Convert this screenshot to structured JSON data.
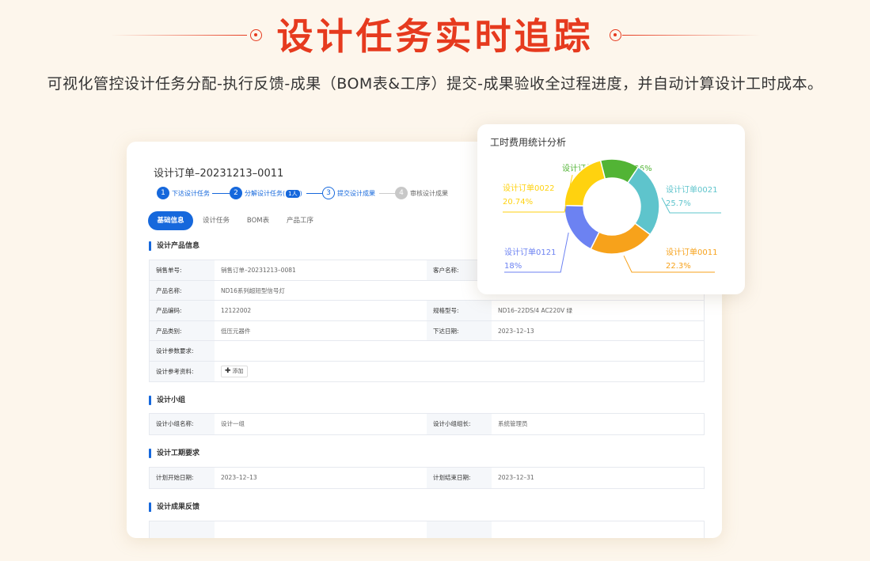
{
  "header": {
    "title": "设计任务实时追踪",
    "subtitle": "可视化管控设计任务分配-执行反馈-成果（BOM表&工序）提交-成果验收全过程进度，并自动计算设计工时成本。"
  },
  "colors": {
    "accent": "#e63a1e",
    "primary": "#1668dc"
  },
  "order": {
    "title": "设计订单–20231213–0011",
    "steps": [
      {
        "num": "1",
        "label": "下达设计任务"
      },
      {
        "num": "2",
        "label": "分解设计任务",
        "badge": "1人"
      },
      {
        "num": "3",
        "label": "提交设计成果"
      },
      {
        "num": "4",
        "label": "审核设计成果"
      }
    ],
    "tabs": [
      "基础信息",
      "设计任务",
      "BOM表",
      "产品工序"
    ]
  },
  "sections": {
    "product": {
      "title": "设计产品信息",
      "rows": [
        {
          "l1": "销售单号:",
          "v1": "销售订单–20231213–0081",
          "l2": "客户名称:",
          "v2": ""
        },
        {
          "l1": "产品名称:",
          "v1": "ND16系列超短型信号灯"
        },
        {
          "l1": "产品编码:",
          "v1": "12122002",
          "l2": "规格型号:",
          "v2": "ND16–22DS/4 AC220V 绿"
        },
        {
          "l1": "产品类别:",
          "v1": "低压元器件",
          "l2": "下达日期:",
          "v2": "2023–12–13"
        },
        {
          "l1": "设计参数要求:",
          "v1": ""
        },
        {
          "l1": "设计参考资料:",
          "add_icon": "plus-icon",
          "add_label": "添加"
        }
      ]
    },
    "team": {
      "title": "设计小组",
      "rows": [
        {
          "l1": "设计小组名称:",
          "v1": "设计一组",
          "l2": "设计小组组长:",
          "v2": "系统管理员"
        }
      ]
    },
    "schedule": {
      "title": "设计工期要求",
      "rows": [
        {
          "l1": "计划开始日期:",
          "v1": "2023–12–13",
          "l2": "计划结束日期:",
          "v2": "2023–12–31"
        }
      ]
    },
    "feedback": {
      "title": "设计成果反馈"
    }
  },
  "chart_data": {
    "type": "pie",
    "title": "工时费用统计分析",
    "donut": true,
    "categories": [
      "设计订单0011",
      "设计订单0021",
      "设计订单0011",
      "设计订单0121",
      "设计订单0022"
    ],
    "values": [
      13.26,
      25.7,
      22.3,
      18,
      20.74
    ],
    "labels": [
      "设计订单0011：13.26%",
      "25.7%",
      "22.3%",
      "18%",
      "20.74%"
    ],
    "colors": [
      "#52b435",
      "#5ec4cc",
      "#f7a21b",
      "#6c82f2",
      "#ffd20f"
    ],
    "legend_placement": "outside-labels"
  }
}
